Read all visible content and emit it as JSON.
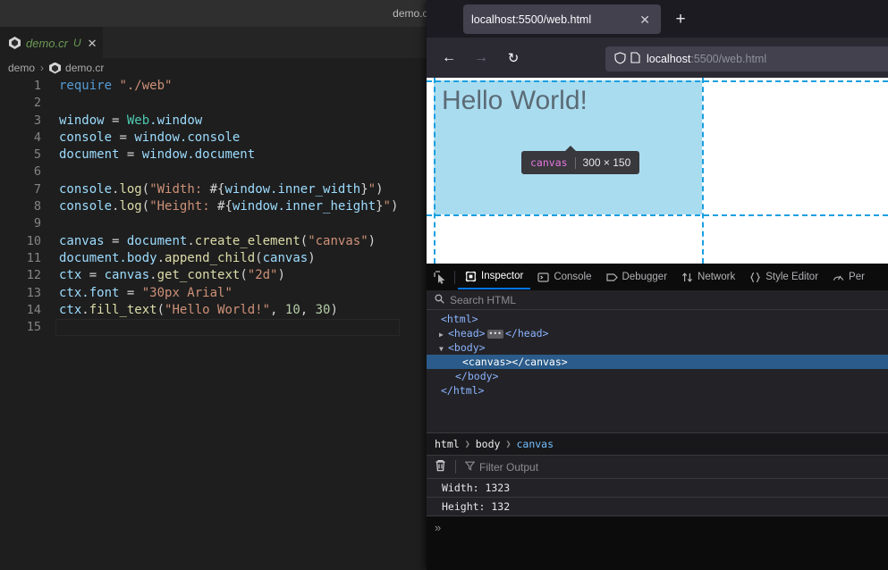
{
  "vscode": {
    "window_title": "demo.cr - crystal-web",
    "tab": {
      "icon": "crystal-file-icon",
      "label": "demo.cr",
      "dirty_badge": "U",
      "close": "✕"
    },
    "breadcrumb": {
      "folder": "demo",
      "separator": "›",
      "file": "demo.cr"
    },
    "code": {
      "language": "crystal",
      "lines": [
        {
          "n": "1",
          "tokens": [
            {
              "t": "require",
              "c": "t-kw"
            },
            {
              "t": " ",
              "c": "t-pun"
            },
            {
              "t": "\"./web\"",
              "c": "t-str"
            }
          ]
        },
        {
          "n": "2",
          "tokens": []
        },
        {
          "n": "3",
          "tokens": [
            {
              "t": "window",
              "c": "t-id"
            },
            {
              "t": " = ",
              "c": "t-pun"
            },
            {
              "t": "Web",
              "c": "t-type"
            },
            {
              "t": ".window",
              "c": "t-id"
            }
          ]
        },
        {
          "n": "4",
          "tokens": [
            {
              "t": "console",
              "c": "t-id"
            },
            {
              "t": " = ",
              "c": "t-pun"
            },
            {
              "t": "window.console",
              "c": "t-id"
            }
          ]
        },
        {
          "n": "5",
          "tokens": [
            {
              "t": "document",
              "c": "t-id"
            },
            {
              "t": " = ",
              "c": "t-pun"
            },
            {
              "t": "window.document",
              "c": "t-id"
            }
          ]
        },
        {
          "n": "6",
          "tokens": []
        },
        {
          "n": "7",
          "tokens": [
            {
              "t": "console",
              "c": "t-id"
            },
            {
              "t": ".",
              "c": "t-pun"
            },
            {
              "t": "log",
              "c": "t-fn"
            },
            {
              "t": "(",
              "c": "t-pun"
            },
            {
              "t": "\"Width: ",
              "c": "t-str"
            },
            {
              "t": "#{",
              "c": "t-pun"
            },
            {
              "t": "window.inner_width",
              "c": "t-id"
            },
            {
              "t": "}",
              "c": "t-pun"
            },
            {
              "t": "\"",
              "c": "t-str"
            },
            {
              "t": ")",
              "c": "t-pun"
            }
          ]
        },
        {
          "n": "8",
          "tokens": [
            {
              "t": "console",
              "c": "t-id"
            },
            {
              "t": ".",
              "c": "t-pun"
            },
            {
              "t": "log",
              "c": "t-fn"
            },
            {
              "t": "(",
              "c": "t-pun"
            },
            {
              "t": "\"Height: ",
              "c": "t-str"
            },
            {
              "t": "#{",
              "c": "t-pun"
            },
            {
              "t": "window.inner_height",
              "c": "t-id"
            },
            {
              "t": "}",
              "c": "t-pun"
            },
            {
              "t": "\"",
              "c": "t-str"
            },
            {
              "t": ")",
              "c": "t-pun"
            }
          ]
        },
        {
          "n": "9",
          "tokens": []
        },
        {
          "n": "10",
          "tokens": [
            {
              "t": "canvas",
              "c": "t-id"
            },
            {
              "t": " = ",
              "c": "t-pun"
            },
            {
              "t": "document",
              "c": "t-id"
            },
            {
              "t": ".",
              "c": "t-pun"
            },
            {
              "t": "create_element",
              "c": "t-fn"
            },
            {
              "t": "(",
              "c": "t-pun"
            },
            {
              "t": "\"canvas\"",
              "c": "t-str"
            },
            {
              "t": ")",
              "c": "t-pun"
            }
          ]
        },
        {
          "n": "11",
          "tokens": [
            {
              "t": "document.body",
              "c": "t-id"
            },
            {
              "t": ".",
              "c": "t-pun"
            },
            {
              "t": "append_child",
              "c": "t-fn"
            },
            {
              "t": "(",
              "c": "t-pun"
            },
            {
              "t": "canvas",
              "c": "t-id"
            },
            {
              "t": ")",
              "c": "t-pun"
            }
          ]
        },
        {
          "n": "12",
          "tokens": [
            {
              "t": "ctx",
              "c": "t-id"
            },
            {
              "t": " = ",
              "c": "t-pun"
            },
            {
              "t": "canvas",
              "c": "t-id"
            },
            {
              "t": ".",
              "c": "t-pun"
            },
            {
              "t": "get_context",
              "c": "t-fn"
            },
            {
              "t": "(",
              "c": "t-pun"
            },
            {
              "t": "\"2d\"",
              "c": "t-str"
            },
            {
              "t": ")",
              "c": "t-pun"
            }
          ]
        },
        {
          "n": "13",
          "tokens": [
            {
              "t": "ctx.font",
              "c": "t-id"
            },
            {
              "t": " = ",
              "c": "t-pun"
            },
            {
              "t": "\"30px Arial\"",
              "c": "t-str"
            }
          ]
        },
        {
          "n": "14",
          "tokens": [
            {
              "t": "ctx",
              "c": "t-id"
            },
            {
              "t": ".",
              "c": "t-pun"
            },
            {
              "t": "fill_text",
              "c": "t-fn"
            },
            {
              "t": "(",
              "c": "t-pun"
            },
            {
              "t": "\"Hello World!\"",
              "c": "t-str"
            },
            {
              "t": ", ",
              "c": "t-pun"
            },
            {
              "t": "10",
              "c": "t-num"
            },
            {
              "t": ", ",
              "c": "t-pun"
            },
            {
              "t": "30",
              "c": "t-num"
            },
            {
              "t": ")",
              "c": "t-pun"
            }
          ]
        },
        {
          "n": "15",
          "tokens": [],
          "current": true
        }
      ]
    }
  },
  "browser": {
    "tab": {
      "title": "localhost:5500/web.html",
      "close_icon": "close-icon",
      "close_glyph": "✕"
    },
    "new_tab_glyph": "+",
    "nav": {
      "back_glyph": "←",
      "forward_glyph": "→",
      "reload_glyph": "↻"
    },
    "urlbar": {
      "shield_icon": "shield-icon",
      "page_icon": "page-icon",
      "host": "localhost",
      "rest": ":5500/web.html"
    },
    "page": {
      "canvas_text": "Hello World!",
      "highlight_color": "#aadcf0",
      "guide_color": "#1a9fe0",
      "tooltip": {
        "tag": "canvas",
        "dimensions": "300 × 150"
      }
    },
    "devtools": {
      "picker_icon": "element-picker-icon",
      "tabs": [
        {
          "label": "Inspector",
          "icon": "inspector-icon",
          "active": true
        },
        {
          "label": "Console",
          "icon": "console-icon",
          "active": false
        },
        {
          "label": "Debugger",
          "icon": "debugger-icon",
          "active": false
        },
        {
          "label": "Network",
          "icon": "network-icon",
          "active": false
        },
        {
          "label": "Style Editor",
          "icon": "style-editor-icon",
          "active": false
        },
        {
          "label": "Per",
          "icon": "performance-icon",
          "active": false
        }
      ],
      "search": {
        "icon": "search-icon",
        "placeholder": "Search HTML"
      },
      "markup": [
        {
          "indent": 0,
          "twisty": "",
          "text": "<html>",
          "selected": false,
          "ellipsis": false
        },
        {
          "indent": 1,
          "twisty": "▶",
          "text": "<head>",
          "after": "</head>",
          "selected": false,
          "ellipsis": true
        },
        {
          "indent": 1,
          "twisty": "▼",
          "text": "<body>",
          "selected": false,
          "ellipsis": false
        },
        {
          "indent": 3,
          "twisty": "",
          "text": "<canvas></canvas>",
          "selected": true,
          "ellipsis": false
        },
        {
          "indent": 2,
          "twisty": "",
          "text": "</body>",
          "selected": false,
          "ellipsis": false
        },
        {
          "indent": 0,
          "twisty": "",
          "text": "</html>",
          "selected": false,
          "ellipsis": false
        }
      ],
      "breadcrumb": [
        {
          "label": "html",
          "current": false
        },
        {
          "label": "body",
          "current": false
        },
        {
          "label": "canvas",
          "current": true
        }
      ],
      "breadcrumb_sep": "❯",
      "console": {
        "clear_icon": "trash-icon",
        "filter_icon": "filter-icon",
        "filter_placeholder": "Filter Output",
        "rows": [
          "Width: 1323",
          "Height: 132"
        ],
        "prompt_glyph": "»"
      }
    }
  }
}
